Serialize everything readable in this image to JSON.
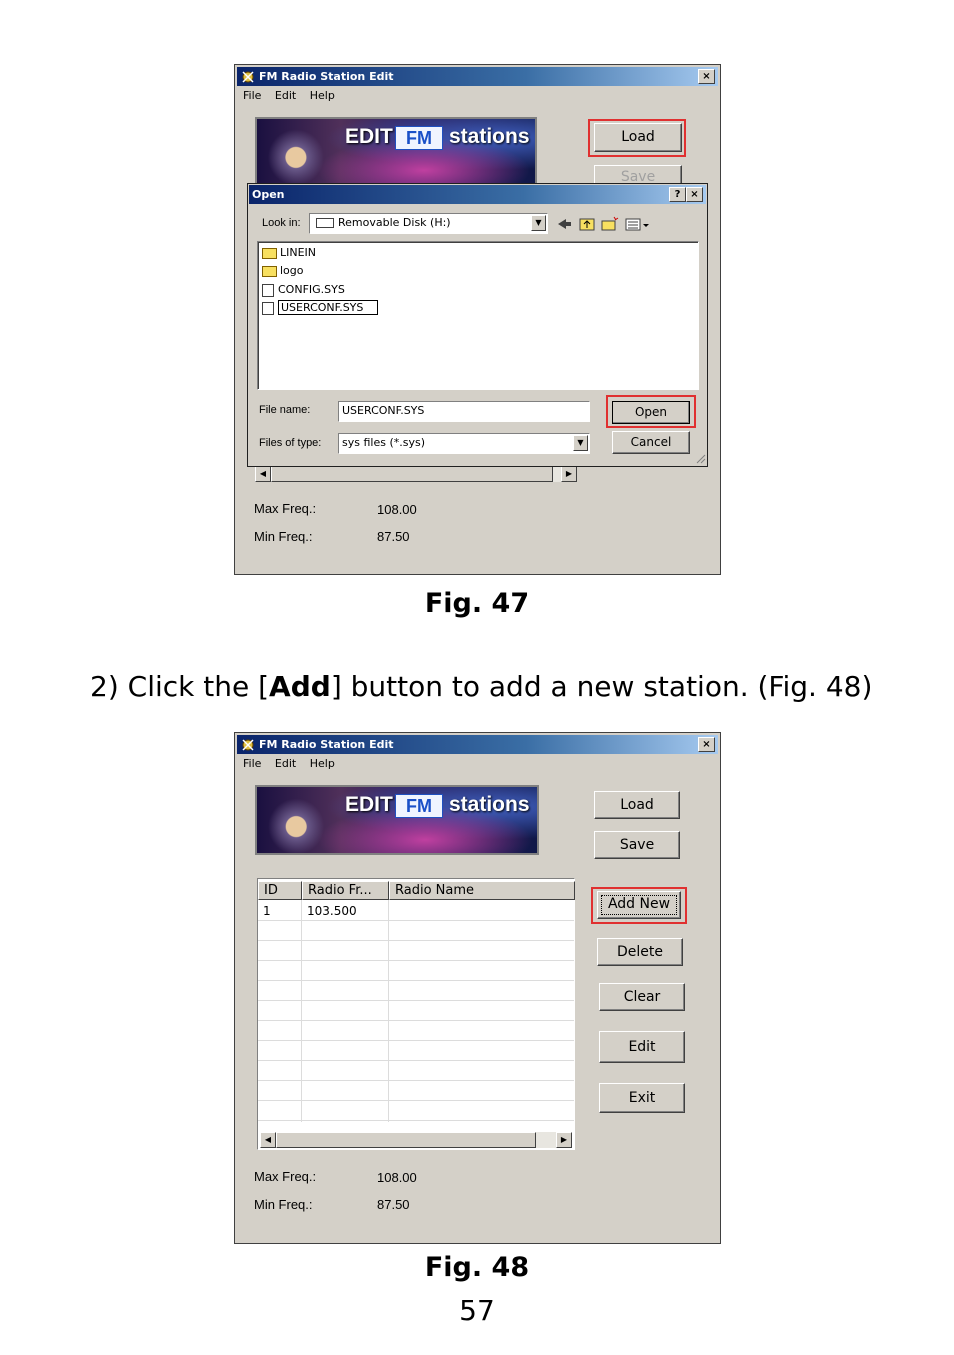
{
  "fig47": {
    "window_title": "FM Radio Station Edit",
    "menu": [
      "File",
      "Edit",
      "Help"
    ],
    "banner": {
      "edit": "EDIT",
      "fm": "FM",
      "stations": "stations"
    },
    "load_label": "Load",
    "save_label": "Save",
    "open_dialog": {
      "title": "Open",
      "help_btn": "?",
      "close_btn": "×",
      "look_in_label": "Look in:",
      "look_in_value": "Removable Disk (H:)",
      "files": [
        {
          "name": "LINEIN",
          "type": "folder"
        },
        {
          "name": "logo",
          "type": "folder"
        },
        {
          "name": "CONFIG.SYS",
          "type": "file"
        },
        {
          "name": "USERCONF.SYS",
          "type": "file"
        }
      ],
      "file_name_label": "File name:",
      "file_name_value": "USERCONF.SYS",
      "files_of_type_label": "Files of type:",
      "files_of_type_value": "sys files (*.sys)",
      "open_label": "Open",
      "cancel_label": "Cancel"
    },
    "max_freq_label": "Max Freq.:",
    "max_freq_value": "108.00",
    "min_freq_label": "Min Freq.:",
    "min_freq_value": "87.50",
    "close_btn": "×"
  },
  "caption47": "Fig. 47",
  "instruction": {
    "prefix": "2) Click the [",
    "bold": "Add",
    "suffix": "] button to add a new station. (Fig. 48)"
  },
  "fig48": {
    "window_title": "FM Radio Station Edit",
    "menu": [
      "File",
      "Edit",
      "Help"
    ],
    "banner": {
      "edit": "EDIT",
      "fm": "FM",
      "stations": "stations"
    },
    "load_label": "Load",
    "save_label": "Save",
    "columns": [
      "ID",
      "Radio Fr...",
      "Radio Name"
    ],
    "rows": [
      {
        "id": "1",
        "freq": "103.500",
        "name": ""
      }
    ],
    "buttons": {
      "add_new": "Add New",
      "delete": "Delete",
      "clear": "Clear",
      "edit": "Edit",
      "exit": "Exit"
    },
    "max_freq_label": "Max Freq.:",
    "max_freq_value": "108.00",
    "min_freq_label": "Min Freq.:",
    "min_freq_value": "87.50",
    "close_btn": "×"
  },
  "caption48": "Fig. 48",
  "page_number": "57"
}
